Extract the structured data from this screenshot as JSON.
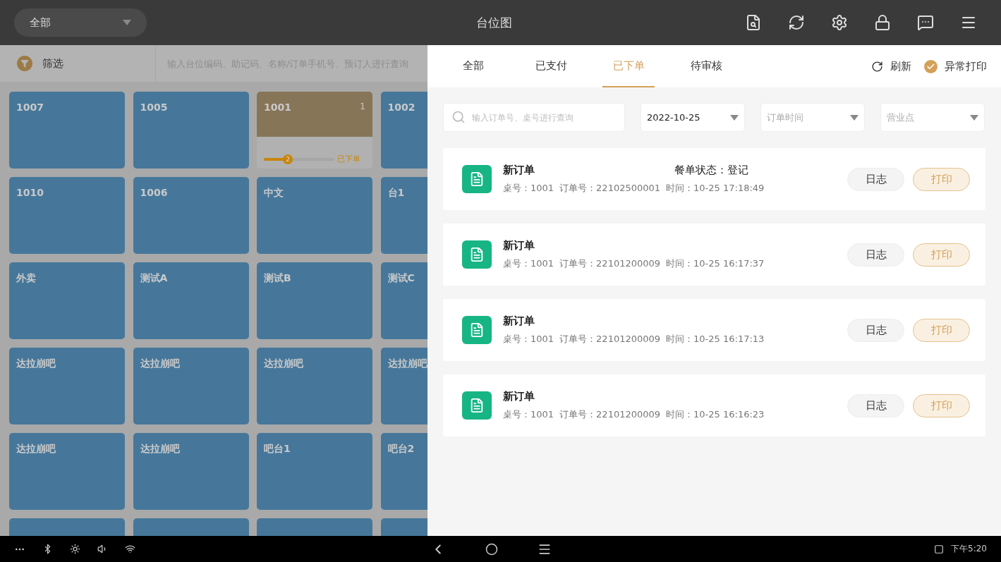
{
  "top_bar": {
    "scope_dropdown": {
      "value": "全部"
    },
    "title": "台位图"
  },
  "filter_bar": {
    "label": "筛选",
    "placeholder": "输入台位编码、助记码、名称/订单手机号、预订人进行查询"
  },
  "tables": [
    {
      "kind": "table",
      "name": "1007"
    },
    {
      "kind": "table",
      "name": "1005"
    },
    {
      "kind": "ordered",
      "name": "1001",
      "count": "1",
      "progress_badge": "2",
      "level": 0.34,
      "status": "已下单"
    },
    {
      "kind": "table",
      "name": "1002"
    },
    {
      "kind": "table",
      "name": "1010"
    },
    {
      "kind": "table",
      "name": "1006"
    },
    {
      "kind": "table",
      "name": "中文"
    },
    {
      "kind": "table",
      "name": "台1"
    },
    {
      "kind": "table",
      "name": "外卖"
    },
    {
      "kind": "table",
      "name": "测试A"
    },
    {
      "kind": "table",
      "name": "测试B"
    },
    {
      "kind": "table",
      "name": "测试C"
    },
    {
      "kind": "table",
      "name": "达拉崩吧"
    },
    {
      "kind": "table",
      "name": "达拉崩吧"
    },
    {
      "kind": "table",
      "name": "达拉崩吧"
    },
    {
      "kind": "table",
      "name": "达拉崩吧"
    },
    {
      "kind": "table",
      "name": "达拉崩吧"
    },
    {
      "kind": "table",
      "name": "达拉崩吧"
    },
    {
      "kind": "table",
      "name": "吧台1"
    },
    {
      "kind": "table",
      "name": "吧台2"
    },
    {
      "kind": "table"
    },
    {
      "kind": "table"
    },
    {
      "kind": "table"
    },
    {
      "kind": "table"
    }
  ],
  "order_panel": {
    "tabs": [
      {
        "label": "全部",
        "selected": false
      },
      {
        "label": "已支付",
        "selected": false
      },
      {
        "label": "已下单",
        "selected": true
      },
      {
        "label": "待审核",
        "selected": false
      }
    ],
    "refresh": "刷新",
    "abnormal_print": {
      "label": "异常打印",
      "checked": true
    },
    "search": {
      "placeholder": "输入订单号、桌号进行查询"
    },
    "date_dropdown": {
      "value": "2022-10-25"
    },
    "time_dropdown": {
      "placeholder": "订单时间"
    },
    "outlet_dropdown": {
      "placeholder": "营业点"
    },
    "orders": [
      {
        "title": "新订单",
        "status": "餐单状态：登记",
        "table": "桌号：1001",
        "order_no": "订单号：22102500001",
        "time": "时间：10-25 17:18:49",
        "log_button": "日志",
        "print_button": "打印"
      },
      {
        "title": "新订单",
        "table": "桌号：1001",
        "order_no": "订单号：22101200009",
        "time": "时间：10-25 16:17:37",
        "log_button": "日志",
        "print_button": "打印"
      },
      {
        "title": "新订单",
        "table": "桌号：1001",
        "order_no": "订单号：22101200009",
        "time": "时间：10-25 16:17:13",
        "log_button": "日志",
        "print_button": "打印"
      },
      {
        "title": "新订单",
        "table": "桌号：1001",
        "order_no": "订单号：22101200009",
        "time": "时间：10-25 16:16:23",
        "log_button": "日志",
        "print_button": "打印"
      }
    ]
  },
  "nav_bar": {
    "clock": "下午5:20"
  }
}
